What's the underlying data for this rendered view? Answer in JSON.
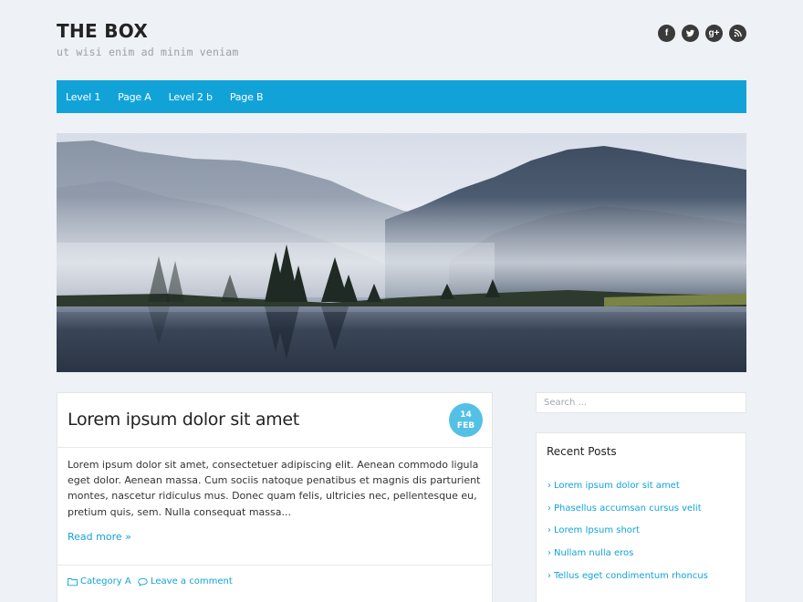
{
  "header": {
    "title": "THE BOX",
    "description": "ut wisi enim ad minim veniam",
    "social": [
      {
        "icon": "facebook-icon",
        "glyph": "f"
      },
      {
        "icon": "twitter-icon",
        "glyph": "t"
      },
      {
        "icon": "google-plus-icon",
        "glyph": "g+"
      },
      {
        "icon": "rss-icon",
        "glyph": ""
      }
    ]
  },
  "nav": {
    "items": [
      "Level 1",
      "Page A",
      "Level 2 b",
      "Page B"
    ]
  },
  "colors": {
    "accent": "#11a3d8",
    "badge": "#55c0e6",
    "background": "#eef1f5"
  },
  "post": {
    "title": "Lorem ipsum dolor sit amet",
    "date_day": "14",
    "date_month": "FEB",
    "excerpt": "Lorem ipsum dolor sit amet, consectetuer adipiscing elit. Aenean commodo ligula eget dolor. Aenean massa. Cum sociis natoque penatibus et magnis dis parturient montes, nascetur ridiculus mus. Donec quam felis, ultricies nec, pellentesque eu, pretium quis, sem. Nulla consequat massa...",
    "read_more": "Read more »",
    "category": "Category A",
    "comment": "Leave a comment"
  },
  "sidebar": {
    "search_placeholder": "Search ...",
    "recent_title": "Recent Posts",
    "recent_posts": [
      "Lorem ipsum dolor sit amet",
      "Phasellus accumsan cursus velit",
      "Lorem Ipsum short",
      "Nullam nulla eros",
      "Tellus eget condimentum rhoncus"
    ]
  }
}
